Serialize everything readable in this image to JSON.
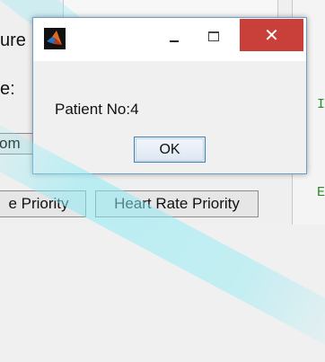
{
  "background": {
    "heading_fragment": "ure",
    "label_fragment": "e:",
    "bom_button_label": "om",
    "priority_button_1_label": "e Priority",
    "priority_button_2_label": "Heart Rate Priority",
    "side_text_1": "I",
    "side_text_2": "E"
  },
  "dialog": {
    "app_icon": "matlab-icon",
    "minimize_icon": "minimize-icon",
    "maximize_icon": "maximize-icon",
    "close_glyph": "✕",
    "message": "Patient No:4",
    "ok_label": "OK",
    "close_color": "#c9403a"
  }
}
